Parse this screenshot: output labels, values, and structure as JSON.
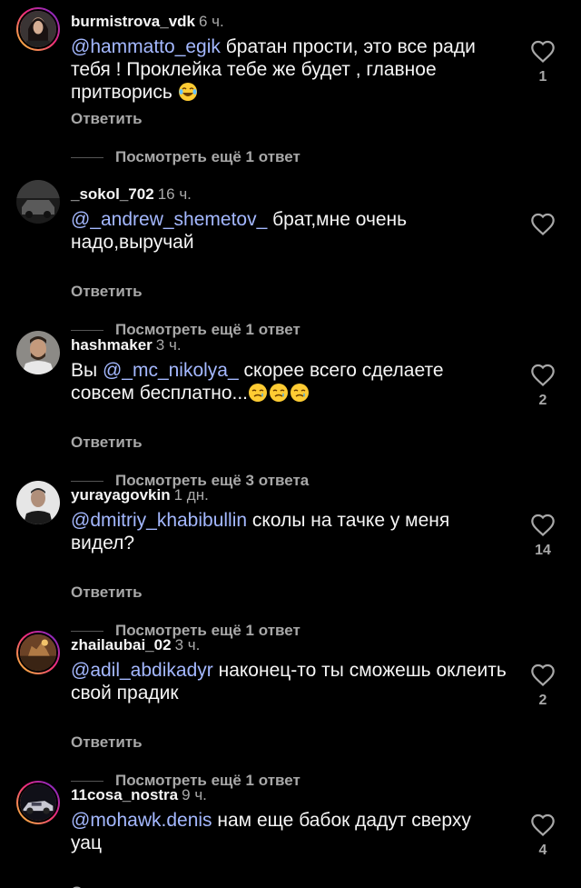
{
  "reply_label": "Ответить",
  "comments": [
    {
      "username": "burmistrova_vdk",
      "time": "6 ч.",
      "mention": "@hammatto_egik",
      "text": "братан прости, это все ради тебя ! Проклейка тебе же будет , главное притворись",
      "emoji": "😂",
      "likes": "1",
      "view_replies": "Посмотреть ещё 1 ответ"
    },
    {
      "username": "_sokol_702",
      "time": "16 ч.",
      "mention": "@_andrew_shemetov_",
      "text": "брат,мне очень надо,выручай",
      "emoji": "",
      "likes": "",
      "view_replies": "Посмотреть ещё 1 ответ"
    },
    {
      "username": "hashmaker",
      "time": "3 ч.",
      "prefix": "Вы",
      "mention": "@_mc_nikolya_",
      "text": "скорее всего сделаете совсем бесплатно...",
      "emoji": "🥲🥲🥲",
      "likes": "2",
      "view_replies": "Посмотреть ещё 3 ответа"
    },
    {
      "username": "yurayagovkin",
      "time": "1 дн.",
      "mention": "@dmitriy_khabibullin",
      "text": "сколы на тачке у меня видел?",
      "emoji": "",
      "likes": "14",
      "view_replies": "Посмотреть ещё 1 ответ"
    },
    {
      "username": "zhailaubai_02",
      "time": "3 ч.",
      "mention": "@adil_abdikadyr",
      "text": "наконец-то ты сможешь оклеить свой прадик",
      "emoji": "",
      "likes": "2",
      "view_replies": "Посмотреть ещё 1 ответ"
    },
    {
      "username": "11cosa_nostra",
      "time": "9 ч.",
      "mention": "@mohawk.denis",
      "text": "нам еще бабок дадут сверху уац",
      "emoji": "",
      "likes": "4"
    }
  ],
  "colors": {
    "background": "#000000",
    "text": "#f5f5f5",
    "secondary": "#a8a8a8",
    "mention": "#a4b8ff"
  }
}
